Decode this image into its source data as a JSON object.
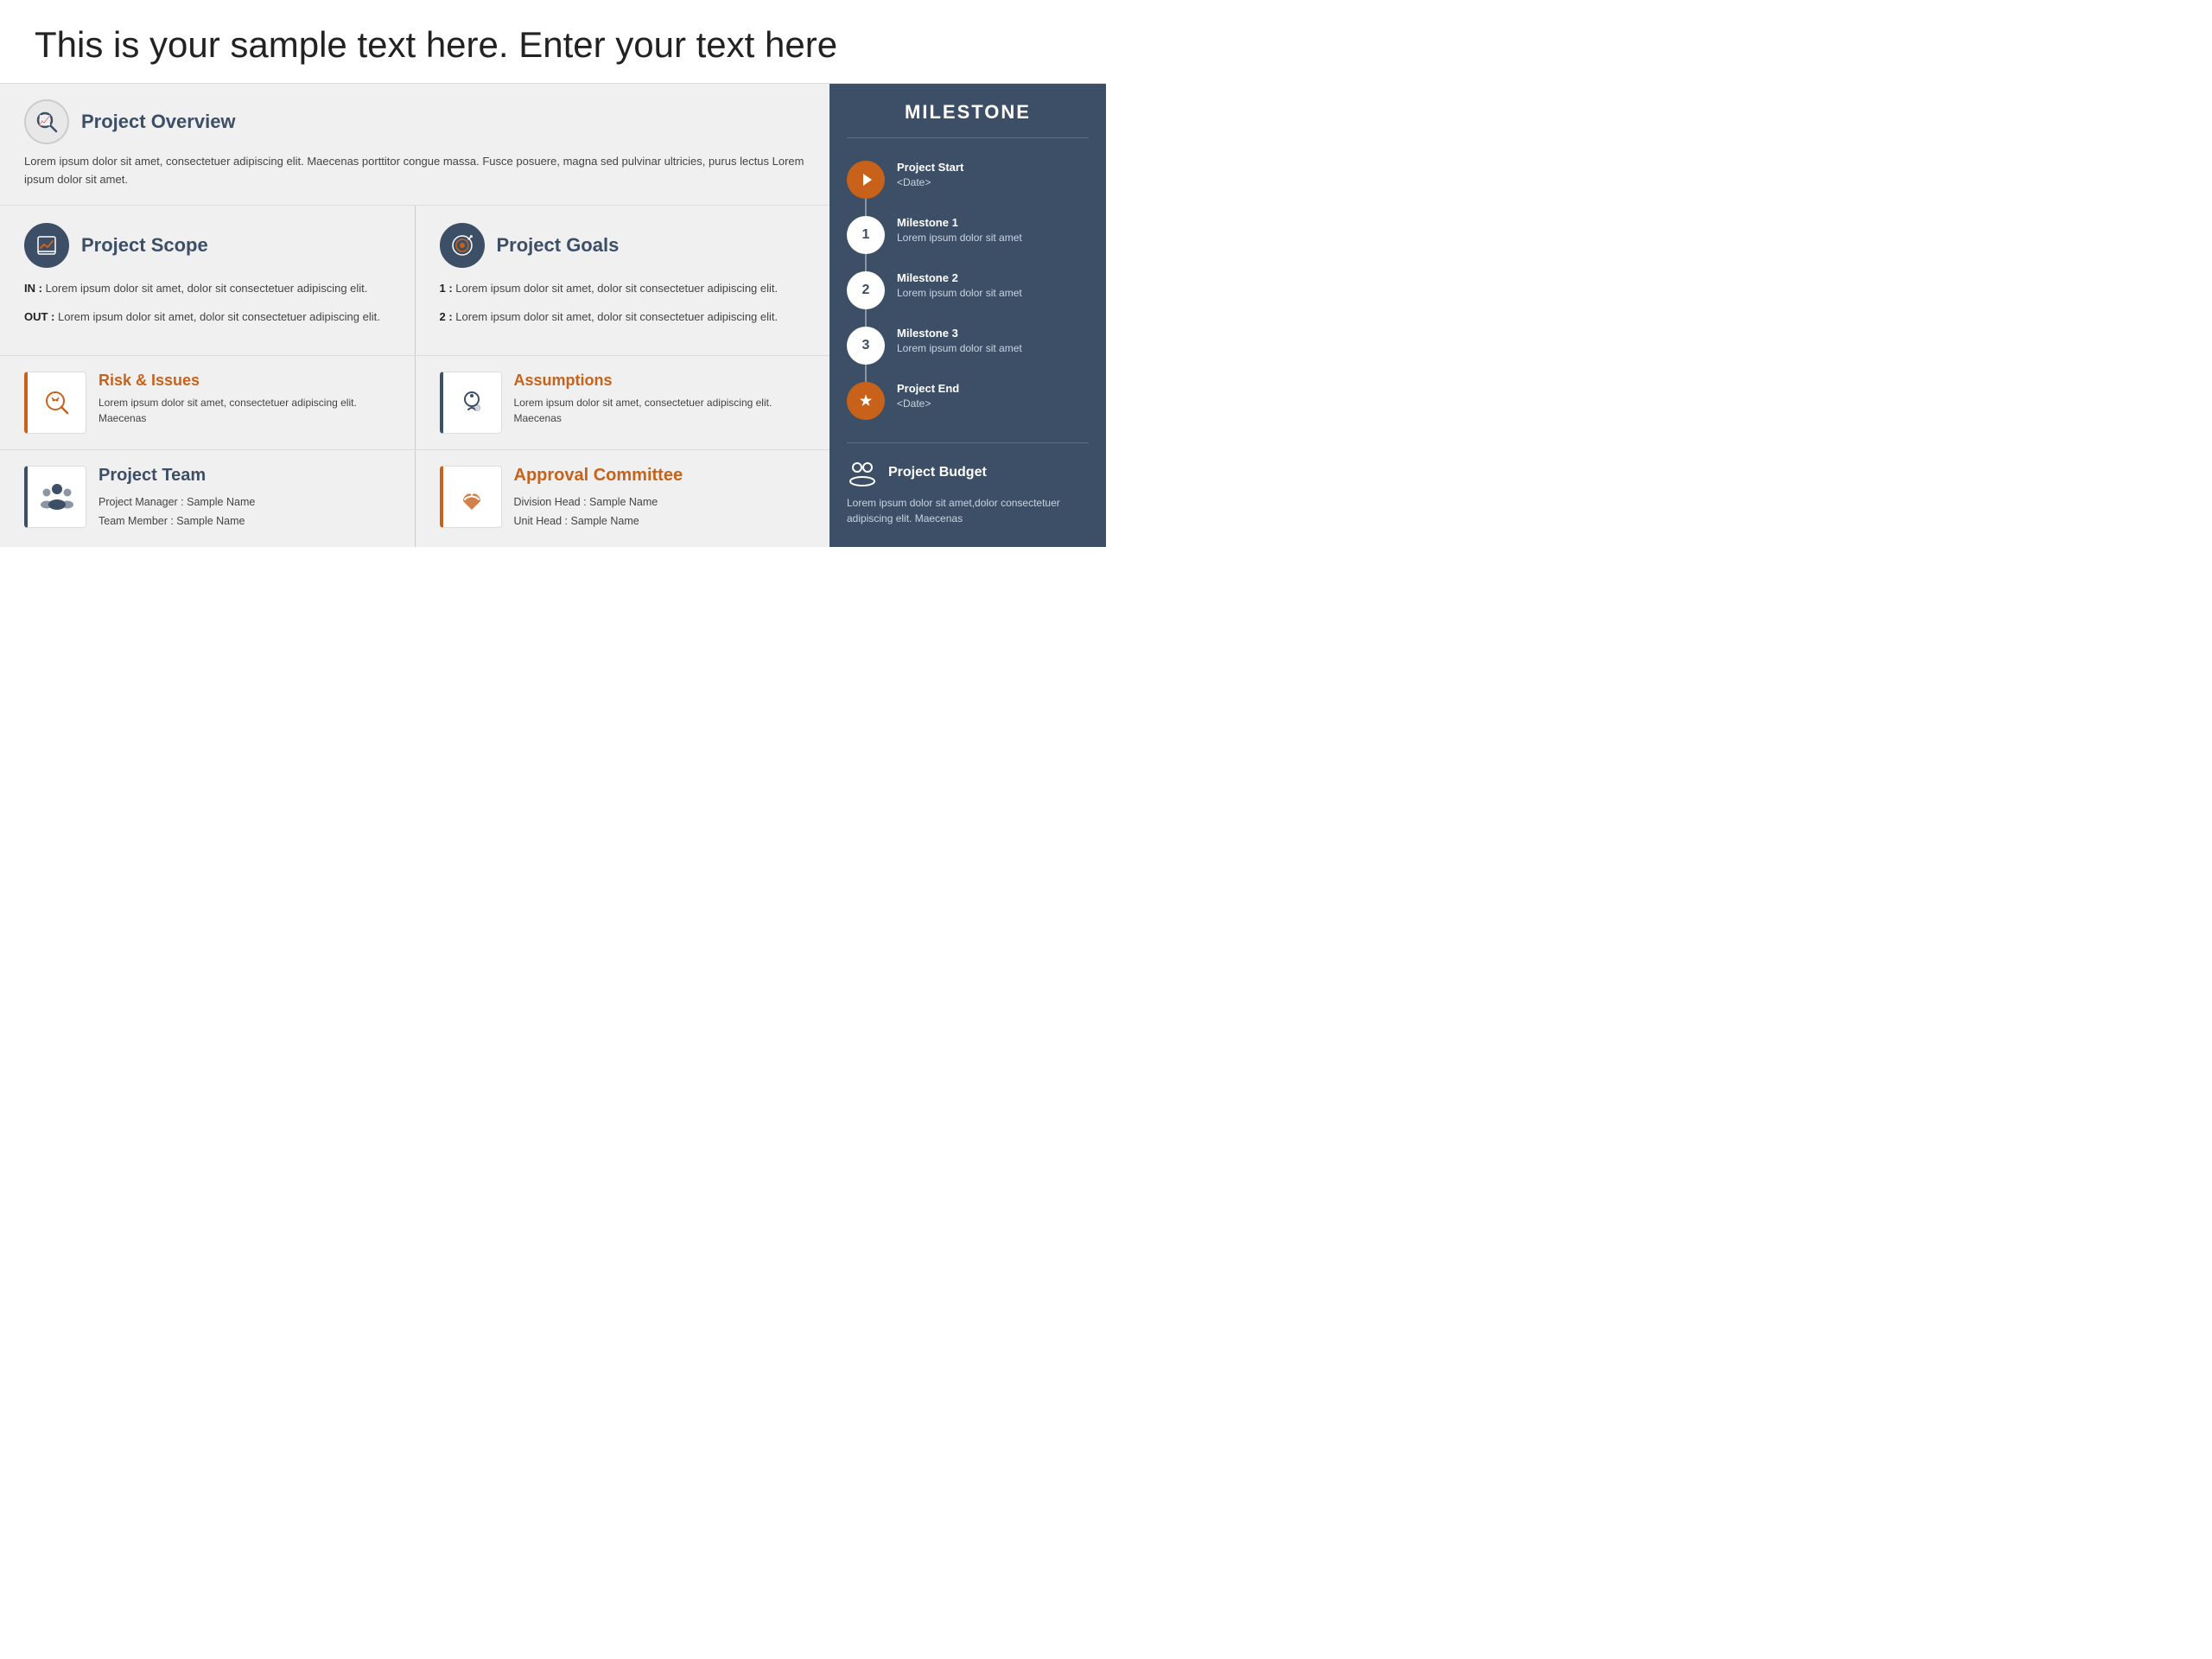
{
  "page": {
    "title": "This is your sample text here. Enter your text here"
  },
  "overview": {
    "section_title": "Project Overview",
    "body_text": "Lorem ipsum dolor sit amet, consectetuer adipiscing elit. Maecenas porttitor congue massa. Fusce posuere, magna sed pulvinar ultricies, purus lectus Lorem ipsum dolor sit amet."
  },
  "scope": {
    "section_title": "Project Scope",
    "items": [
      {
        "label": "IN :",
        "text": "Lorem ipsum dolor sit amet, dolor sit consectetuer adipiscing elit."
      },
      {
        "label": "OUT :",
        "text": "Lorem ipsum dolor sit amet, dolor sit consectetuer adipiscing elit."
      }
    ]
  },
  "goals": {
    "section_title": "Project Goals",
    "items": [
      {
        "label": "1 :",
        "text": "Lorem ipsum dolor sit amet, dolor sit consectetuer adipiscing elit."
      },
      {
        "label": "2 :",
        "text": "Lorem ipsum dolor sit amet, dolor sit consectetuer adipiscing elit."
      }
    ]
  },
  "risk": {
    "title": "Risk & Issues",
    "text": "Lorem ipsum dolor sit amet, consectetuer adipiscing elit. Maecenas"
  },
  "assumptions": {
    "title": "Assumptions",
    "text": "Lorem ipsum dolor sit amet, consectetuer adipiscing elit. Maecenas"
  },
  "team": {
    "title": "Project Team",
    "items": [
      "Project Manager : Sample Name",
      "Team Member : Sample Name"
    ]
  },
  "approval": {
    "title": "Approval Committee",
    "items": [
      "Division Head : Sample Name",
      "Unit Head : Sample Name"
    ]
  },
  "milestone": {
    "section_title": "MILESTONE",
    "items": [
      {
        "type": "orange",
        "label": "▶",
        "title": "Project Start",
        "subtitle": "<Date>"
      },
      {
        "type": "white",
        "label": "1",
        "title": "Milestone 1",
        "subtitle": "Lorem ipsum dolor sit amet"
      },
      {
        "type": "white",
        "label": "2",
        "title": "Milestone 2",
        "subtitle": "Lorem ipsum dolor sit amet"
      },
      {
        "type": "white",
        "label": "3",
        "title": "Milestone 3",
        "subtitle": "Lorem ipsum dolor sit amet"
      },
      {
        "type": "orange",
        "label": "★",
        "title": "Project End",
        "subtitle": "<Date>"
      }
    ]
  },
  "budget": {
    "title": "Project Budget",
    "text": "Lorem ipsum dolor sit amet,dolor consectetuer adipiscing elit. Maecenas"
  }
}
